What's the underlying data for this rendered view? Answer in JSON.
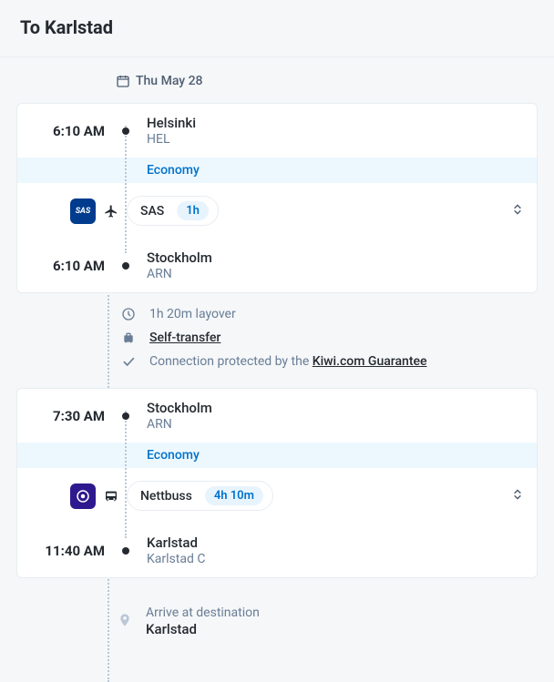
{
  "header": {
    "title": "To Karlstad"
  },
  "date": {
    "label": "Thu May 28"
  },
  "leg1": {
    "dep": {
      "time": "6:10 AM",
      "city": "Helsinki",
      "code": "HEL"
    },
    "cabin": "Economy",
    "carrier": {
      "name": "SAS",
      "duration": "1h",
      "logo_text": "SAS"
    },
    "arr": {
      "time": "6:10 AM",
      "city": "Stockholm",
      "code": "ARN"
    }
  },
  "layover": {
    "duration": "1h 20m layover",
    "self_transfer": "Self-transfer",
    "protect_prefix": "Connection protected by the ",
    "protect_link": "Kiwi.com Guarantee"
  },
  "leg2": {
    "dep": {
      "time": "7:30 AM",
      "city": "Stockholm",
      "code": "ARN"
    },
    "cabin": "Economy",
    "carrier": {
      "name": "Nettbuss",
      "duration": "4h 10m"
    },
    "arr": {
      "time": "11:40 AM",
      "city": "Karlstad",
      "code": "Karlstad C"
    }
  },
  "arrive": {
    "label": "Arrive at destination",
    "city": "Karlstad"
  }
}
